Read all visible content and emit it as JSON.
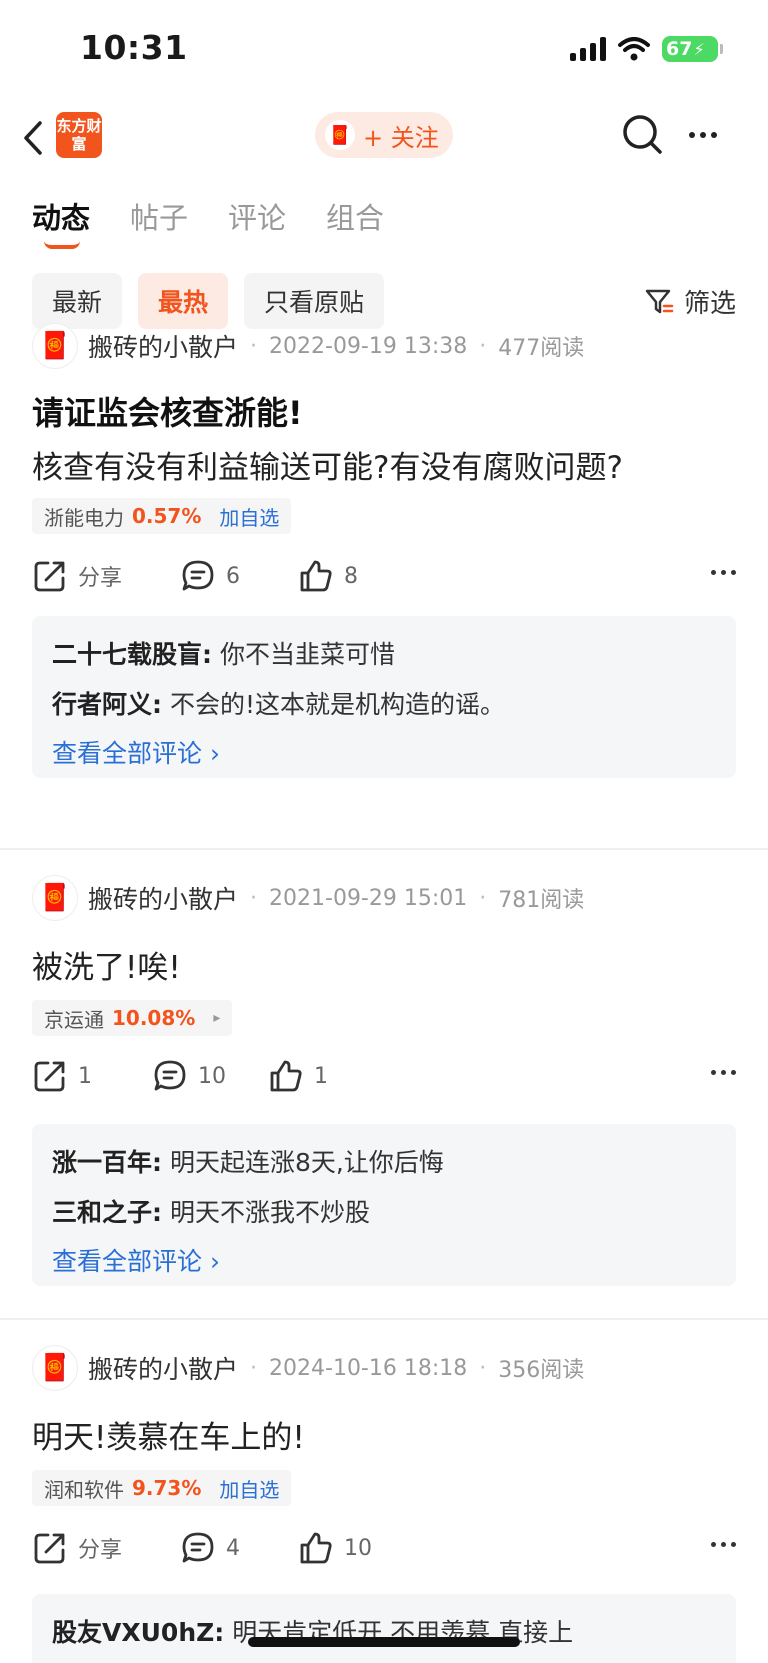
{
  "status_bar": {
    "time": "10:31",
    "battery": "67"
  },
  "nav": {
    "logo_text": "东方财富",
    "follow_label": "+ 关注"
  },
  "tabs": [
    "动态",
    "帖子",
    "评论",
    "组合"
  ],
  "filters": {
    "chips": [
      "最新",
      "最热",
      "只看原贴"
    ],
    "filter_label": "筛选"
  },
  "posts": [
    {
      "author": "搬砖的小散户",
      "date": "2022-09-19 13:38",
      "reads": "477阅读",
      "title": "请证监会核查浙能!",
      "body": "核查有没有利益输送可能?有没有腐败问题?",
      "stock": {
        "name": "浙能电力",
        "change": "0.57%",
        "action": "加自选"
      },
      "share": "分享",
      "comment_count": "6",
      "like_count": "8",
      "comments": [
        {
          "user": "二十七载股盲:",
          "text": "你不当韭菜可惜"
        },
        {
          "user": "行者阿义:",
          "text": "不会的!这本就是机构造的谣。"
        }
      ],
      "view_all": "查看全部评论 ›"
    },
    {
      "author": "搬砖的小散户",
      "date": "2021-09-29 15:01",
      "reads": "781阅读",
      "body": "被洗了!唉!",
      "stock": {
        "name": "京运通",
        "change": "10.08%",
        "action": "▸"
      },
      "share": "1",
      "comment_count": "10",
      "like_count": "1",
      "comments": [
        {
          "user": "涨一百年:",
          "text": "明天起连涨8天,让你后悔"
        },
        {
          "user": "三和之子:",
          "text": "明天不涨我不炒股"
        }
      ],
      "view_all": "查看全部评论 ›"
    },
    {
      "author": "搬砖的小散户",
      "date": "2024-10-16 18:18",
      "reads": "356阅读",
      "body": "明天!羡慕在车上的!",
      "stock": {
        "name": "润和软件",
        "change": "9.73%",
        "action": "加自选"
      },
      "share": "分享",
      "comment_count": "4",
      "like_count": "10",
      "comments": [
        {
          "user": "股友VXU0hZ:",
          "text": "明天肯定低开 不用羡慕 直接上"
        }
      ]
    }
  ],
  "colors": {
    "accent": "#f2541e",
    "link": "#2a6fd6"
  }
}
